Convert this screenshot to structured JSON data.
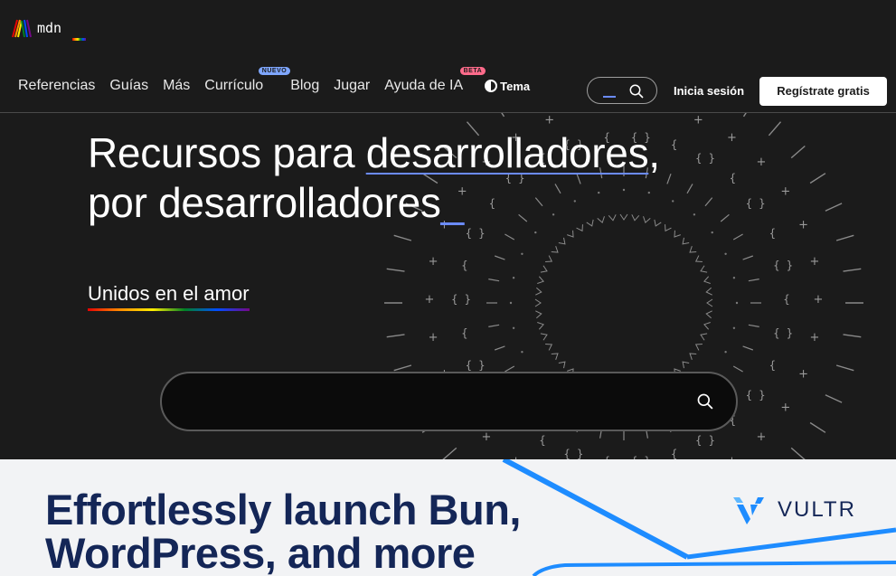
{
  "header": {
    "logo_text": "mdn",
    "nav_items": [
      {
        "label": "Referencias"
      },
      {
        "label": "Guías"
      },
      {
        "label": "Más"
      },
      {
        "label": "Currículo",
        "badge": "NUEVO"
      },
      {
        "label": "Blog"
      },
      {
        "label": "Jugar"
      },
      {
        "label": "Ayuda de IA",
        "badge": "BETA"
      }
    ],
    "theme_label": "Tema",
    "search_icon": "search-icon",
    "login_label": "Inicia sesión",
    "signup_label": "Regístrate gratis"
  },
  "hero": {
    "title_prefix": "Recursos para ",
    "title_highlight": "desarrolladores",
    "title_suffix": ",",
    "title_line2": "por desarrolladores",
    "title_cursor": "_",
    "tagline": "Unidos en el amor",
    "search_icon": "search-icon"
  },
  "ad": {
    "headline_line1": "Effortlessly launch Bun,",
    "headline_line2": "WordPress, and more",
    "brand": "VULTR",
    "brand_color": "#142657",
    "accent_color": "#1e8cff"
  },
  "colors": {
    "background": "#1b1b1b",
    "accent": "#6b8bff",
    "ad_background": "#f2f3f5"
  }
}
